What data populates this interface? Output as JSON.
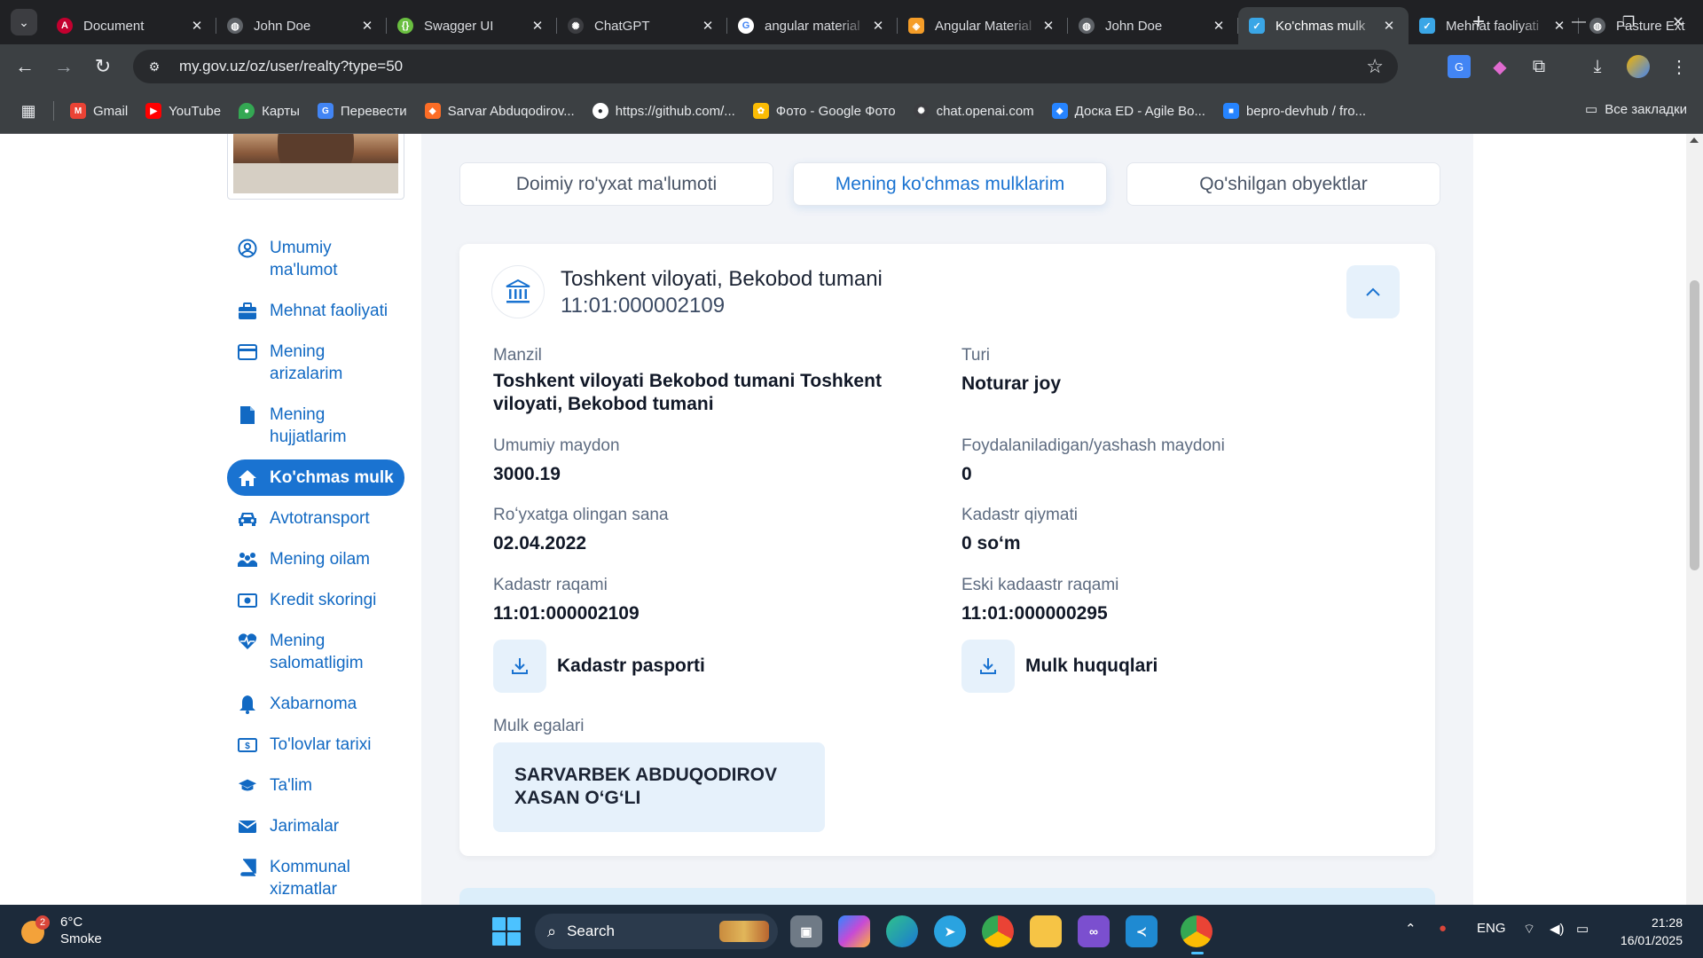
{
  "browser": {
    "tabs": [
      {
        "title": "Document",
        "favicon_color": "#c3002f",
        "favicon_glyph": "A",
        "icon": "angular-icon",
        "active": false
      },
      {
        "title": "John Doe",
        "favicon_color": "#5f6368",
        "favicon_glyph": "",
        "icon": "globe-icon",
        "active": false
      },
      {
        "title": "Swagger UI",
        "favicon_color": "#6abf40",
        "favicon_glyph": "",
        "icon": "swagger-icon",
        "active": false
      },
      {
        "title": "ChatGPT",
        "favicon_color": "#3c3d41",
        "favicon_glyph": "✺",
        "icon": "chatgpt-icon",
        "active": false
      },
      {
        "title": "angular material",
        "favicon_color": "#ffffff",
        "favicon_glyph": "G",
        "icon": "google-icon",
        "active": false
      },
      {
        "title": "Angular Material",
        "favicon_color": "#f59d28",
        "favicon_glyph": "",
        "icon": "shield-icon",
        "active": false
      },
      {
        "title": "John Doe",
        "favicon_color": "#5f6368",
        "favicon_glyph": "",
        "icon": "globe-icon",
        "active": false
      },
      {
        "title": "Ko'chmas mulk",
        "favicon_color": "#3aa6e6",
        "favicon_glyph": "",
        "icon": "mygov-icon",
        "active": true
      },
      {
        "title": "Mehnat faoliyati",
        "favicon_color": "#3aa6e6",
        "favicon_glyph": "",
        "icon": "mygov-icon",
        "active": false
      },
      {
        "title": "Pasture Ext",
        "favicon_color": "#5f6368",
        "favicon_glyph": "",
        "icon": "globe-icon",
        "active": false
      }
    ],
    "url": "my.gov.uz/oz/user/realty?type=50",
    "bookmarks": [
      {
        "label": "Gmail",
        "icon": "gmail-icon",
        "color": "#ea4335",
        "glyph": "M"
      },
      {
        "label": "YouTube",
        "icon": "youtube-icon",
        "color": "#ff0000",
        "glyph": "▶"
      },
      {
        "label": "Карты",
        "icon": "maps-icon",
        "color": "#34a853",
        "glyph": "●"
      },
      {
        "label": "Перевести",
        "icon": "translate-icon",
        "color": "#4285f4",
        "glyph": "G"
      },
      {
        "label": "Sarvar Abduqodirov...",
        "icon": "gitlab-icon",
        "color": "#fc6d26",
        "glyph": "◆"
      },
      {
        "label": "https://github.com/...",
        "icon": "github-icon",
        "color": "#24292e",
        "glyph": "●"
      },
      {
        "label": "Фото - Google Фото",
        "icon": "photos-icon",
        "color": "#fbbc04",
        "glyph": "✿"
      },
      {
        "label": "chat.openai.com",
        "icon": "chatgpt-icon",
        "color": "#3c3d41",
        "glyph": "✺"
      },
      {
        "label": "Доска ED - Agile Bo...",
        "icon": "jira-icon",
        "color": "#2684ff",
        "glyph": "◆"
      },
      {
        "label": "bepro-devhub / fro...",
        "icon": "bitbucket-icon",
        "color": "#2684ff",
        "glyph": "■"
      }
    ],
    "all_bookmarks_label": "Все закладки"
  },
  "sidebar": {
    "items": [
      {
        "label": "Umumiy ma'lumot",
        "icon": "user-circle-icon",
        "active": false
      },
      {
        "label": "Mehnat faoliyati",
        "icon": "briefcase-icon",
        "active": false
      },
      {
        "label": "Mening arizalarim",
        "icon": "card-icon",
        "active": false
      },
      {
        "label": "Mening hujjatlarim",
        "icon": "document-icon",
        "active": false
      },
      {
        "label": "Ko'chmas mulk",
        "icon": "home-icon",
        "active": true
      },
      {
        "label": "Avtotransport",
        "icon": "car-icon",
        "active": false
      },
      {
        "label": "Mening oilam",
        "icon": "family-icon",
        "active": false
      },
      {
        "label": "Kredit skoringi",
        "icon": "money-icon",
        "active": false
      },
      {
        "label": "Mening salomatligim",
        "icon": "heart-pulse-icon",
        "active": false
      },
      {
        "label": "Xabarnoma",
        "icon": "bell-icon",
        "active": false
      },
      {
        "label": "To'lovlar tarixi",
        "icon": "payment-icon",
        "active": false
      },
      {
        "label": "Ta'lim",
        "icon": "graduation-cap-icon",
        "active": false
      },
      {
        "label": "Jarimalar",
        "icon": "envelope-icon",
        "active": false
      },
      {
        "label": "Kommunal xizmatlar",
        "icon": "book-icon",
        "active": false
      }
    ]
  },
  "main": {
    "tabs": [
      {
        "label": "Doimiy ro'yxat ma'lumoti",
        "active": false
      },
      {
        "label": "Mening ko'chmas mulklarim",
        "active": true
      },
      {
        "label": "Qo'shilgan obyektlar",
        "active": false
      }
    ],
    "property": {
      "title": "Toshkent viloyati, Bekobod tumani",
      "cadastre_subtitle": "11:01:000002109",
      "fields": {
        "address_label": "Manzil",
        "address_value": "Toshkent viloyati Bekobod tumani Toshkent viloyati, Bekobod tumani",
        "type_label": "Turi",
        "type_value": "Noturar joy",
        "total_area_label": "Umumiy maydon",
        "total_area_value": "3000.19",
        "living_area_label": "Foydalaniladigan/yashash maydoni",
        "living_area_value": "0",
        "reg_date_label": "Roʻyxatga olingan sana",
        "reg_date_value": "02.04.2022",
        "cadastre_value_label": "Kadastr qiymati",
        "cadastre_value_value": "0 soʻm",
        "cadastre_number_label": "Kadastr raqami",
        "cadastre_number_value": "11:01:000002109",
        "old_cadastre_label": "Eski kadaastr raqami",
        "old_cadastre_value": "11:01:000000295"
      },
      "downloads": {
        "passport_label": "Kadastr pasporti",
        "rights_label": "Mulk huquqlari"
      },
      "owners_label": "Mulk egalari",
      "owner_name": "SARVARBEK ABDUQODIROV XASAN OʻGʻLI"
    }
  },
  "taskbar": {
    "weather_temp": "6°C",
    "weather_desc": "Smoke",
    "weather_badge": "2",
    "search_placeholder": "Search",
    "language": "ENG",
    "time": "21:28",
    "date": "16/01/2025"
  },
  "colors": {
    "accent": "#1a73d1",
    "menu_text": "#1169c3",
    "light_blue": "#e6f1fb"
  }
}
